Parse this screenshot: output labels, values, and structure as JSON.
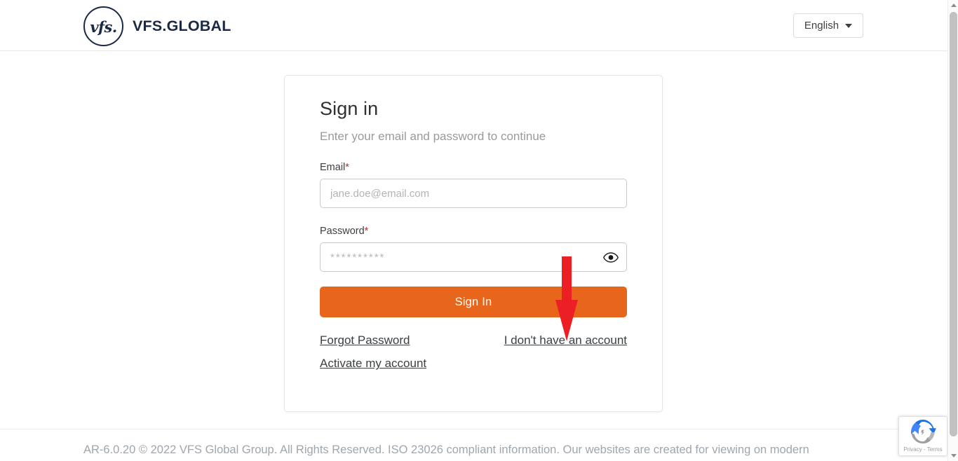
{
  "header": {
    "brand_mark_text": "vfs.",
    "brand_name": "VFS.GLOBAL",
    "language_label": "English"
  },
  "card": {
    "title": "Sign in",
    "subtitle": "Enter your email and password to continue",
    "email": {
      "label": "Email",
      "required_marker": "*",
      "placeholder": "jane.doe@email.com",
      "value": ""
    },
    "password": {
      "label": "Password",
      "required_marker": "*",
      "placeholder": "**********",
      "value": "",
      "toggle_icon": "eye-icon"
    },
    "submit_label": "Sign In",
    "links": {
      "forgot_password": "Forgot Password",
      "no_account": "I don't have an account",
      "activate_account": "Activate my account"
    }
  },
  "footer": {
    "text": "AR-6.0.20 © 2022 VFS Global Group. All Rights Reserved. ISO 23026 compliant information. Our websites are created for viewing on modern"
  },
  "recaptcha": {
    "privacy_terms": "Privacy - Terms"
  },
  "annotation": {
    "arrow_color": "#ec2024",
    "arrow_direction": "down",
    "points_to": "I don't have an account"
  },
  "colors": {
    "brand_navy": "#1b2a44",
    "accent_orange": "#e8661c",
    "required_red": "#b03030",
    "footer_gray": "#9fa6ad"
  }
}
